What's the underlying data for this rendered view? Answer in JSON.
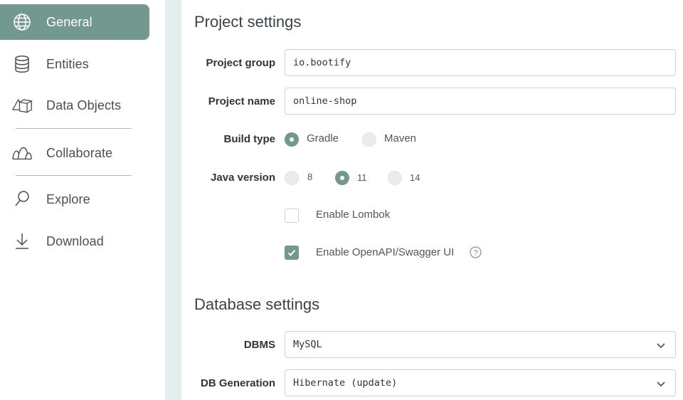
{
  "sidebar": {
    "items": [
      {
        "label": "General",
        "icon": "globe-icon",
        "active": true
      },
      {
        "label": "Entities",
        "icon": "database-icon"
      },
      {
        "label": "Data Objects",
        "icon": "data-objects-icon"
      },
      {
        "label": "Collaborate",
        "icon": "collaborate-icon"
      },
      {
        "label": "Explore",
        "icon": "search-icon"
      },
      {
        "label": "Download",
        "icon": "download-icon"
      }
    ]
  },
  "project": {
    "title": "Project settings",
    "group_label": "Project group",
    "group_value": "io.bootify",
    "name_label": "Project name",
    "name_value": "online-shop",
    "build_label": "Build type",
    "build_options": [
      "Gradle",
      "Maven"
    ],
    "build_selected": "Gradle",
    "java_label": "Java version",
    "java_options": [
      "8",
      "11",
      "14"
    ],
    "java_selected": "11",
    "lombok_label": "Enable Lombok",
    "lombok_checked": false,
    "openapi_label": "Enable OpenAPI/Swagger UI",
    "openapi_checked": true
  },
  "database": {
    "title": "Database settings",
    "dbms_label": "DBMS",
    "dbms_value": "MySQL",
    "generation_label": "DB Generation",
    "generation_value": "Hibernate (update)"
  },
  "colors": {
    "accent": "#739890",
    "strip": "#e3efec"
  }
}
